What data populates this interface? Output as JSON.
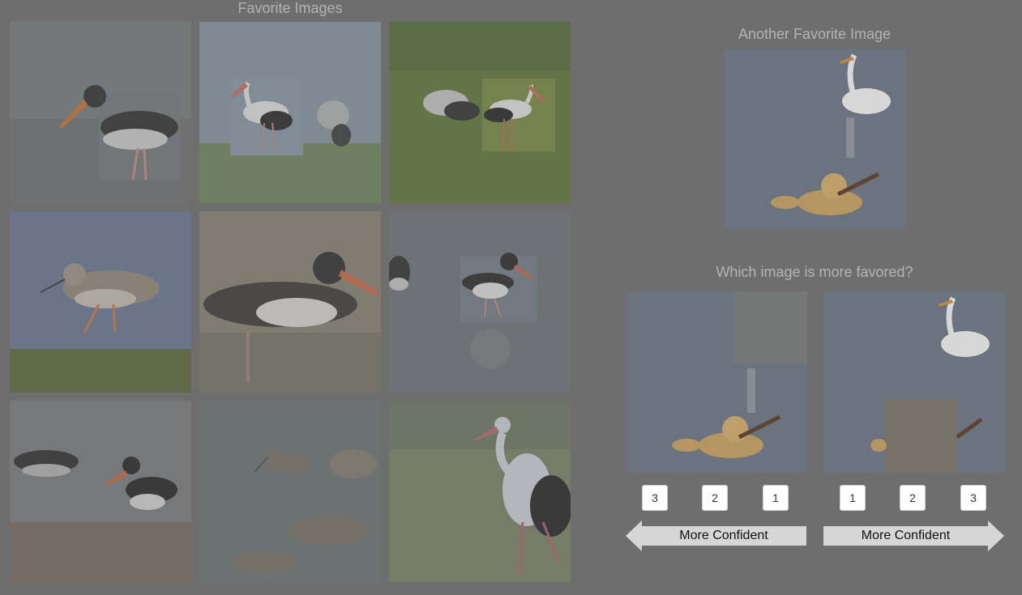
{
  "left_panel": {
    "title": "Favorite Images"
  },
  "reference_panel": {
    "title": "Another Favorite Image"
  },
  "question_panel": {
    "question": "Which image is more favored?",
    "left_option": {
      "ranks": [
        "3",
        "2",
        "1"
      ],
      "confidence_label": "More Confident"
    },
    "right_option": {
      "ranks": [
        "1",
        "2",
        "3"
      ],
      "confidence_label": "More Confident"
    }
  }
}
